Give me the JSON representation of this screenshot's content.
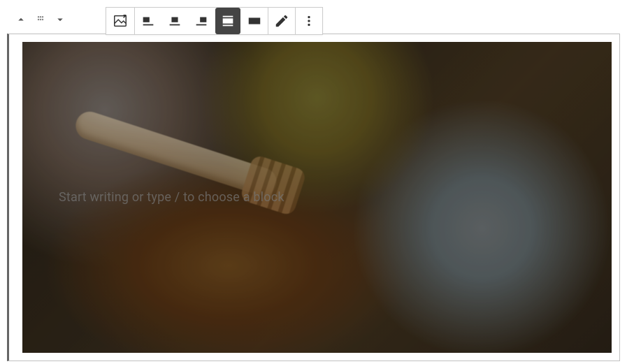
{
  "mover": {
    "up_label": "Move block up",
    "drag_label": "Drag block",
    "down_label": "Move block down"
  },
  "toolbar": {
    "block_type_label": "Change block type",
    "align_left_label": "Align left",
    "align_center_label": "Align center",
    "align_right_label": "Align right",
    "wide_width_label": "Wide width",
    "full_width_label": "Full width",
    "edit_label": "Edit",
    "more_label": "More options",
    "active_alignment": "wide"
  },
  "cover": {
    "placeholder": "Start writing or type / to choose a block",
    "overlay_color": "#000000",
    "overlay_opacity": 0.5
  }
}
